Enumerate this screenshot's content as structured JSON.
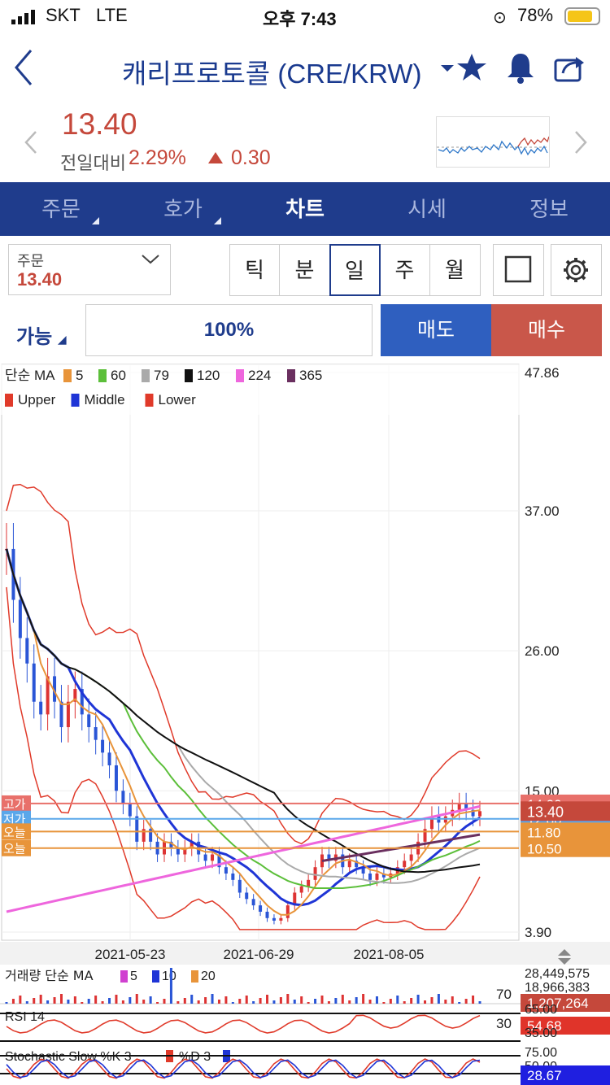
{
  "status_bar": {
    "carrier": "SKT",
    "network": "LTE",
    "time": "오후 7:43",
    "battery": "78%"
  },
  "header": {
    "title": "캐리프로토콜 (CRE/KRW)"
  },
  "quote": {
    "price": "13.40",
    "change_label": "전일대비",
    "change_pct": "2.29%",
    "change_val": "0.30"
  },
  "tabs": [
    {
      "label": "주문"
    },
    {
      "label": "호가"
    },
    {
      "label": "차트"
    },
    {
      "label": "시세"
    },
    {
      "label": "정보"
    }
  ],
  "order_box": {
    "label": "주문",
    "value": "13.40"
  },
  "periods": [
    "틱",
    "분",
    "일",
    "주",
    "월"
  ],
  "actions": {
    "available": "가능",
    "percent": "100%",
    "sell": "매도",
    "buy": "매수"
  },
  "colors": {
    "navy": "#1f3c8c",
    "up": "#c5483b",
    "sell": "#2f5fbf",
    "buy": "#c9574a"
  },
  "chart_data": {
    "type": "candlestick",
    "legend_ma": {
      "label": "단순 MA",
      "periods": [
        "5",
        "60",
        "79",
        "120",
        "224",
        "365"
      ],
      "colors": [
        "#e8943a",
        "#5cbf3a",
        "#aaaaaa",
        "#111111",
        "#ee66dd",
        "#6a2f5f"
      ]
    },
    "legend_bb": [
      {
        "name": "Upper",
        "color": "#e03a2a"
      },
      {
        "name": "Middle",
        "color": "#1f35d6"
      },
      {
        "name": "Lower",
        "color": "#e03a2a"
      }
    ],
    "y_ticks": [
      "47.86",
      "37.00",
      "26.00",
      "15.00",
      "3.90"
    ],
    "y_range": [
      3.9,
      47.86
    ],
    "x_ticks": [
      "2021-05-23",
      "2021-06-29",
      "2021-08-05"
    ],
    "price_tags": {
      "high_label": "고가",
      "low_label": "저가",
      "today1_label": "오늘",
      "today2_label": "오늘",
      "high": "14.00",
      "current": "13.40",
      "low": "12.80",
      "today1": "11.80",
      "today2": "10.50"
    },
    "price_lines": {
      "high": 14.0,
      "current": 13.4,
      "low": 12.8,
      "today1": 11.8,
      "today2": 10.5
    },
    "closes": [
      34,
      30,
      27,
      25,
      22,
      21,
      24,
      22,
      20,
      22,
      23,
      21,
      20,
      19,
      18,
      17,
      15,
      14,
      13,
      11,
      12,
      11,
      10,
      11,
      10.5,
      10,
      10.5,
      11,
      10,
      9.5,
      10,
      9,
      8.5,
      8,
      7,
      6.5,
      6,
      5.5,
      5,
      4.8,
      5,
      6,
      7,
      7.5,
      8,
      9,
      10,
      9.5,
      10,
      9,
      9.5,
      9,
      8.5,
      8,
      8.5,
      8.2,
      8.5,
      9,
      9.5,
      10,
      11,
      12,
      13,
      12.5,
      13,
      13.5,
      14,
      13.5,
      13,
      13.4
    ],
    "volume": {
      "label": "거래량 단순 MA",
      "periods": [
        "5",
        "10",
        "20"
      ],
      "colors": [
        "#d040d0",
        "#1f35d6",
        "#e8943a"
      ],
      "ticks": [
        "28,449,575",
        "18,966,383"
      ],
      "current": "1,207,264"
    },
    "rsi": {
      "label": "RSI 14",
      "levels": [
        "70",
        "30"
      ],
      "axis": [
        "65.00",
        "35.00"
      ],
      "current": "54.68"
    },
    "stochastic": {
      "label": "Stochastic Slow %K 3",
      "d_label": "%D 3",
      "axis": [
        "75.00",
        "50.00"
      ],
      "current": "28.67"
    }
  }
}
